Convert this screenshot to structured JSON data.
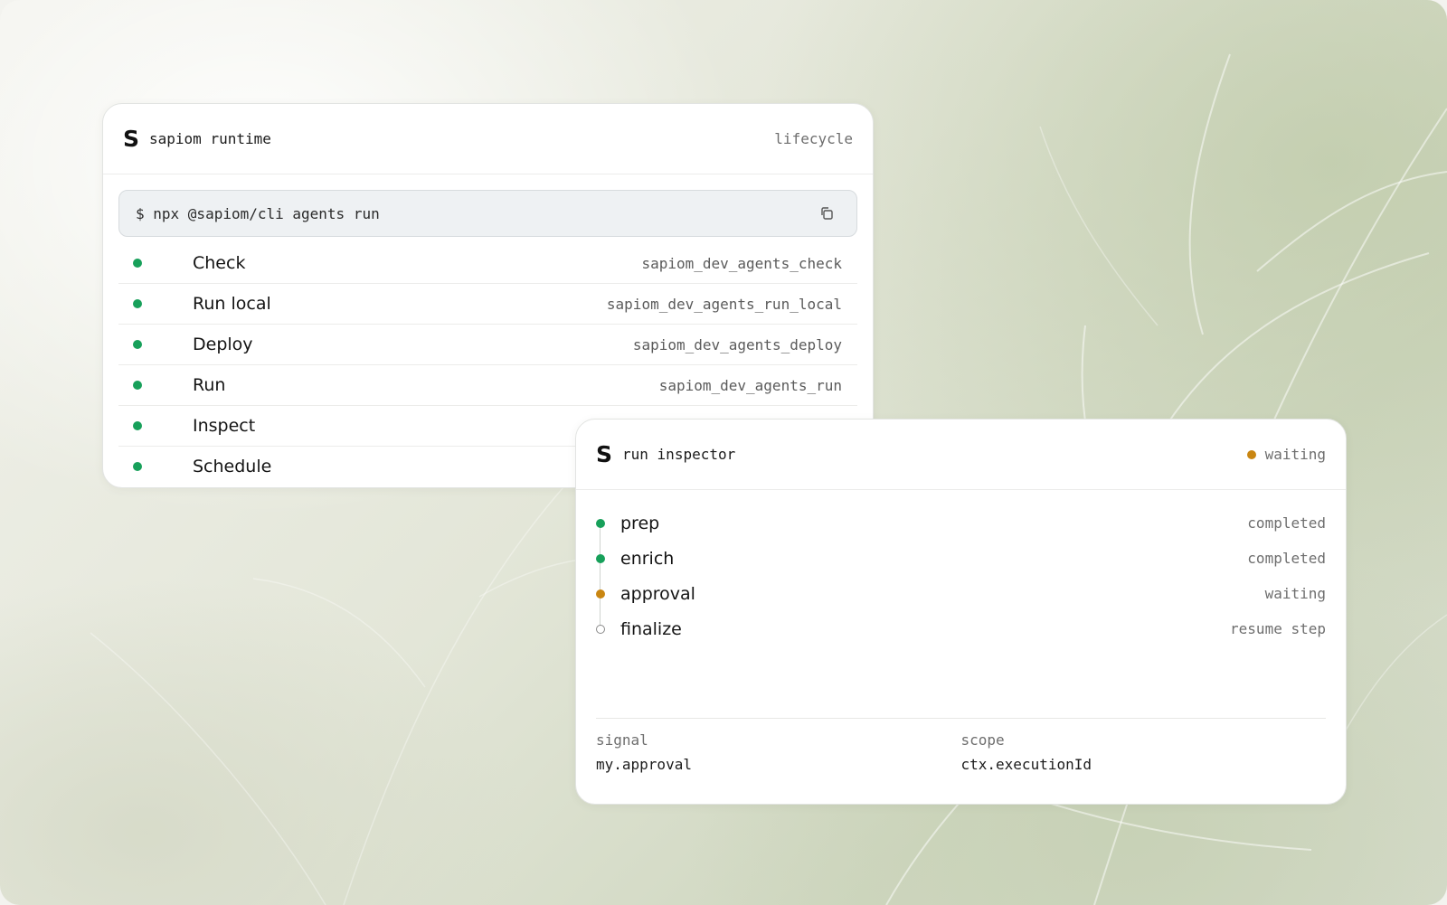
{
  "runtime": {
    "title": "sapiom runtime",
    "tag": "lifecycle",
    "command": "$ npx @sapiom/cli agents run",
    "rows": [
      {
        "label": "Check",
        "key": "sapiom_dev_agents_check"
      },
      {
        "label": "Run local",
        "key": "sapiom_dev_agents_run_local"
      },
      {
        "label": "Deploy",
        "key": "sapiom_dev_agents_deploy"
      },
      {
        "label": "Run",
        "key": "sapiom_dev_agents_run"
      },
      {
        "label": "Inspect",
        "key": ""
      },
      {
        "label": "Schedule",
        "key": ""
      }
    ]
  },
  "inspector": {
    "title": "run inspector",
    "status": "waiting",
    "steps": [
      {
        "label": "prep",
        "status": "completed",
        "state": "done"
      },
      {
        "label": "enrich",
        "status": "completed",
        "state": "done"
      },
      {
        "label": "approval",
        "status": "waiting",
        "state": "waiting"
      },
      {
        "label": "finalize",
        "status": "resume step",
        "state": "pending"
      }
    ],
    "footer": {
      "signal_label": "signal",
      "signal_value": "my.approval",
      "scope_label": "scope",
      "scope_value": "ctx.executionId"
    }
  },
  "brand": {
    "logo_letter": "S",
    "colors": {
      "success": "#17a05a",
      "waiting": "#c98612"
    }
  }
}
